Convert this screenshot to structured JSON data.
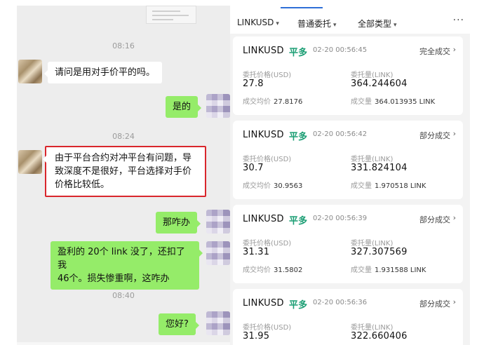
{
  "chat": {
    "times": [
      "08:16",
      "08:24",
      "08:40"
    ],
    "messages": [
      {
        "from": "other",
        "text": "请问是用对手价平的吗。"
      },
      {
        "from": "me",
        "text": "是的"
      },
      {
        "from": "other",
        "line1": "由于平台合约对冲平台有问题，导",
        "line2": "致深度不是很好，平台选择对手价",
        "line3": "价格比较低。",
        "highlighted": true
      },
      {
        "from": "me",
        "text": "那咋办"
      },
      {
        "from": "me",
        "line1": "盈利的 20个 link 没了，还扣了我",
        "line2": "46个。损失惨重啊，这咋办"
      },
      {
        "from": "me",
        "text": "您好?"
      }
    ]
  },
  "filters": {
    "symbol": "LINKUSD",
    "order_type": "普通委托",
    "all_types": "全部类型",
    "more": "···"
  },
  "orders": [
    {
      "symbol": "LINKUSD",
      "side": "平多",
      "time": "02-20 00:56:45",
      "status": "完全成交",
      "price_label": "委托价格(USD)",
      "price": "27.8",
      "qty_label": "委托量(LINK)",
      "qty": "364.244604",
      "avg_label": "成交均价",
      "avg": "27.8176",
      "filled_label": "成交量",
      "filled": "364.013935 LINK"
    },
    {
      "symbol": "LINKUSD",
      "side": "平多",
      "time": "02-20 00:56:42",
      "status": "部分成交",
      "price_label": "委托价格(USD)",
      "price": "30.7",
      "qty_label": "委托量(LINK)",
      "qty": "331.824104",
      "avg_label": "成交均价",
      "avg": "30.9563",
      "filled_label": "成交量",
      "filled": "1.970518 LINK"
    },
    {
      "symbol": "LINKUSD",
      "side": "平多",
      "time": "02-20 00:56:39",
      "status": "部分成交",
      "price_label": "委托价格(USD)",
      "price": "31.31",
      "qty_label": "委托量(LINK)",
      "qty": "327.307569",
      "avg_label": "成交均价",
      "avg": "31.5802",
      "filled_label": "成交量",
      "filled": "1.931588 LINK"
    },
    {
      "symbol": "LINKUSD",
      "side": "平多",
      "time": "02-20 00:56:36",
      "status": "部分成交",
      "price_label": "委托价格(USD)",
      "price": "31.95",
      "qty_label": "委托量(LINK)",
      "qty": "322.660406"
    }
  ],
  "colors": {
    "side_green": "#1b9e74",
    "bubble_green": "#95ec69",
    "highlight_red": "#d9262c",
    "tab_blue": "#2e6fd7"
  }
}
